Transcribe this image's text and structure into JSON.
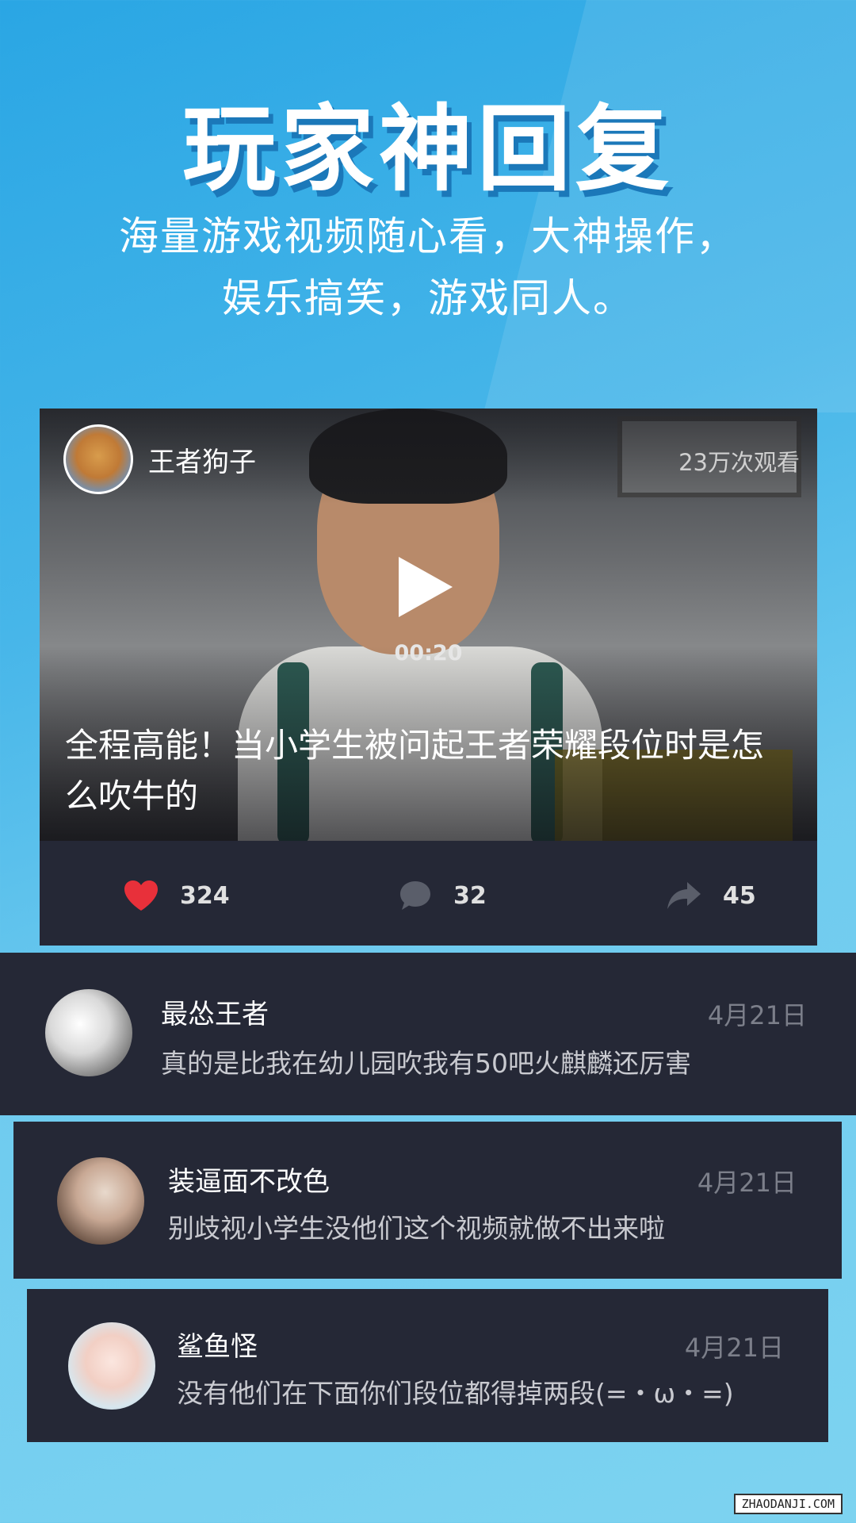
{
  "header": {
    "title": "玩家神回复",
    "subtitle_line1": "海量游戏视频随心看，大神操作，",
    "subtitle_line2": "娱乐搞笑，游戏同人。"
  },
  "video": {
    "author": "王者狗子",
    "views": "23万次观看",
    "duration": "00:20",
    "title": "全程高能！当小学生被问起王者荣耀段位时是怎么吹牛的",
    "likes": "324",
    "comments": "32",
    "shares": "45",
    "like_color": "#e8303a"
  },
  "comments": [
    {
      "name": "最怂王者",
      "date": "4月21日",
      "text": "真的是比我在幼儿园吹我有50吧火麒麟还厉害"
    },
    {
      "name": "装逼面不改色",
      "date": "4月21日",
      "text": "别歧视小学生没他们这个视频就做不出来啦"
    },
    {
      "name": "鲨鱼怪",
      "date": "4月21日",
      "text": "没有他们在下面你们段位都得掉两段(=・ω・=)"
    }
  ],
  "watermark": "ZHAODANJI.COM"
}
